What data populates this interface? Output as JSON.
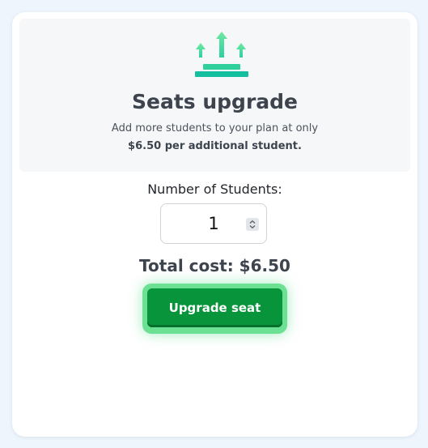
{
  "header": {
    "icon": "upgrade-arrows-icon",
    "title": "Seats upgrade",
    "subtitle_prefix": "Add more students to your plan at only ",
    "subtitle_emphasis": "$6.50 per additional student."
  },
  "form": {
    "label": "Number of Students:",
    "quantity": "1",
    "total": "Total cost: $6.50",
    "button_label": "Upgrade seat"
  },
  "colors": {
    "accent_green": "#08943b",
    "icon_teal": "#1fc5a0",
    "icon_green": "#5fe08c"
  }
}
